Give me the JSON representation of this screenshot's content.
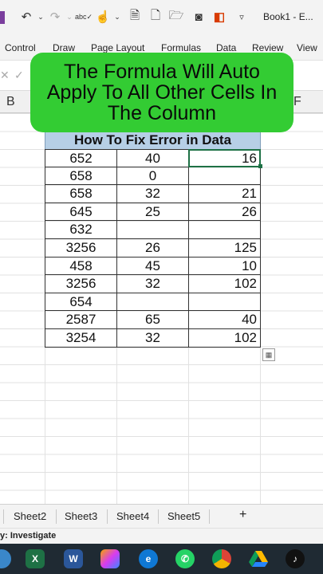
{
  "window": {
    "title": "Book1 - E..."
  },
  "ribbon": {
    "tabs": [
      "Control",
      "Draw",
      "Page Layout",
      "Formulas",
      "Data",
      "Review",
      "View"
    ]
  },
  "columns": {
    "left": "B",
    "right": "F"
  },
  "callout": {
    "text": "The Formula Will Auto Apply To All Other Cells In The Column"
  },
  "table": {
    "title": "How To Fix Error in Data",
    "rows": [
      [
        "652",
        "40",
        "16"
      ],
      [
        "658",
        "0",
        ""
      ],
      [
        "658",
        "32",
        "21"
      ],
      [
        "645",
        "25",
        "26"
      ],
      [
        "632",
        "",
        ""
      ],
      [
        "3256",
        "26",
        "125"
      ],
      [
        "458",
        "45",
        "10"
      ],
      [
        "3256",
        "32",
        "102"
      ],
      [
        "654",
        "",
        ""
      ],
      [
        "2587",
        "65",
        "40"
      ],
      [
        "3254",
        "32",
        "102"
      ]
    ]
  },
  "sheets": {
    "tabs": [
      "Sheet2",
      "Sheet3",
      "Sheet4",
      "Sheet5"
    ],
    "add_label": "+"
  },
  "status": {
    "text": "y: Investigate"
  },
  "taskbar": {
    "apps": [
      "excel-icon",
      "word-icon",
      "copilot-icon",
      "edge-icon",
      "whatsapp-icon",
      "chrome-icon",
      "drive-icon",
      "tiktok-icon"
    ]
  }
}
